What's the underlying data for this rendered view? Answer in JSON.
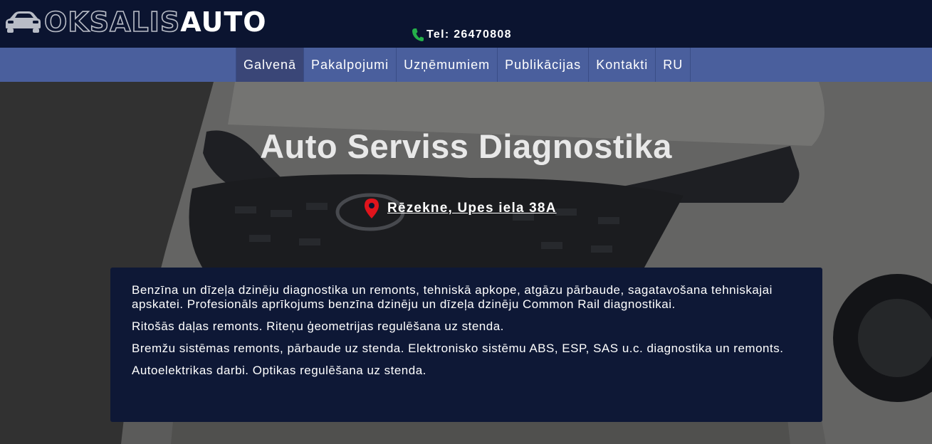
{
  "header": {
    "logo": {
      "part1": "OKSALIS",
      "part2": "AUTO",
      "icon": "car-icon"
    },
    "phone": {
      "label": "Tel: 26470808",
      "icon": "phone-icon",
      "icon_color": "#25b04a"
    }
  },
  "nav": {
    "items": [
      {
        "label": "Galvenā",
        "active": true
      },
      {
        "label": "Pakalpojumi",
        "active": false
      },
      {
        "label": "Uzņēmumiem",
        "active": false
      },
      {
        "label": "Publikācijas",
        "active": false
      },
      {
        "label": "Kontakti",
        "active": false
      },
      {
        "label": "RU",
        "active": false
      }
    ]
  },
  "hero": {
    "title": "Auto Serviss Diagnostika",
    "address": {
      "label": "Rēzekne, Upes iela 38A",
      "icon": "map-pin-icon",
      "icon_color": "#e0141c"
    },
    "paragraphs": [
      "Benzīna un dīzeļa dzinēju diagnostika un remonts, tehniskā apkope, atgāzu pārbaude, sagatavošana tehniskajai apskatei. Profesionāls aprīkojums benzīna dzinēju un dīzeļa dzinēju Common Rail diagnostikai.",
      "Ritošās daļas remonts. Riteņu ģeometrijas regulēšana uz stenda.",
      "Bremžu sistēmas remonts, pārbaude uz stenda. Elektronisko sistēmu ABS, ESP, SAS u.c. diagnostika un remonts.",
      "Autoelektrikas darbi. Optikas regulēšana uz stenda."
    ]
  },
  "colors": {
    "header_bg": "#0b1430",
    "nav_bg": "#4a5f9d",
    "nav_active_bg": "#3a4677",
    "info_bg": "#0e1836"
  }
}
